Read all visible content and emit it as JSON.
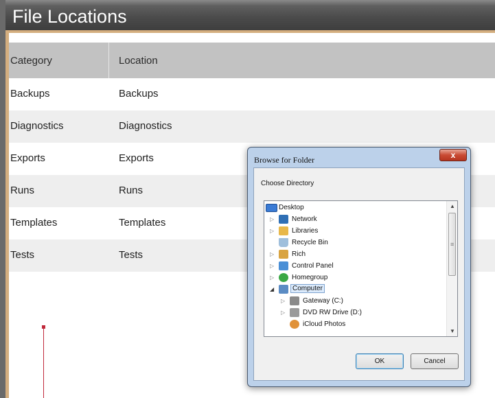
{
  "page": {
    "title": "File Locations"
  },
  "table": {
    "headers": [
      "Category",
      "Location"
    ],
    "rows": [
      [
        "Backups",
        "Backups"
      ],
      [
        "Diagnostics",
        "Diagnostics"
      ],
      [
        "Exports",
        "Exports"
      ],
      [
        "Runs",
        "Runs"
      ],
      [
        "Templates",
        "Templates"
      ],
      [
        "Tests",
        "Tests"
      ]
    ]
  },
  "dialog": {
    "title": "Browse for Folder",
    "close_label": "x",
    "prompt": "Choose Directory",
    "tree": [
      {
        "label": "Desktop",
        "icon": "desktop-icon",
        "color": "#3a7bd5",
        "expander": ""
      },
      {
        "label": "Network",
        "icon": "network-icon",
        "color": "#2f6fb5",
        "expander": "▷"
      },
      {
        "label": "Libraries",
        "icon": "libraries-icon",
        "color": "#e8b84a",
        "expander": "▷"
      },
      {
        "label": "Recycle Bin",
        "icon": "recycle-bin-icon",
        "color": "#7fa6c9",
        "expander": ""
      },
      {
        "label": "Rich",
        "icon": "user-folder-icon",
        "color": "#d9a441",
        "expander": "▷"
      },
      {
        "label": "Control Panel",
        "icon": "control-panel-icon",
        "color": "#4a8fd6",
        "expander": "▷"
      },
      {
        "label": "Homegroup",
        "icon": "homegroup-icon",
        "color": "#3aa845",
        "expander": "▷"
      },
      {
        "label": "Computer",
        "icon": "computer-icon",
        "color": "#5b8cc4",
        "expander": "◢"
      },
      {
        "label": "Gateway (C:)",
        "icon": "drive-icon",
        "color": "#8a8a8a",
        "expander": "▷"
      },
      {
        "label": "DVD RW Drive (D:)",
        "icon": "dvd-drive-icon",
        "color": "#9a9a9a",
        "expander": "▷"
      },
      {
        "label": "iCloud Photos",
        "icon": "icloud-photos-icon",
        "color": "#e0923a",
        "expander": ""
      }
    ],
    "ok_label": "OK",
    "cancel_label": "Cancel"
  }
}
